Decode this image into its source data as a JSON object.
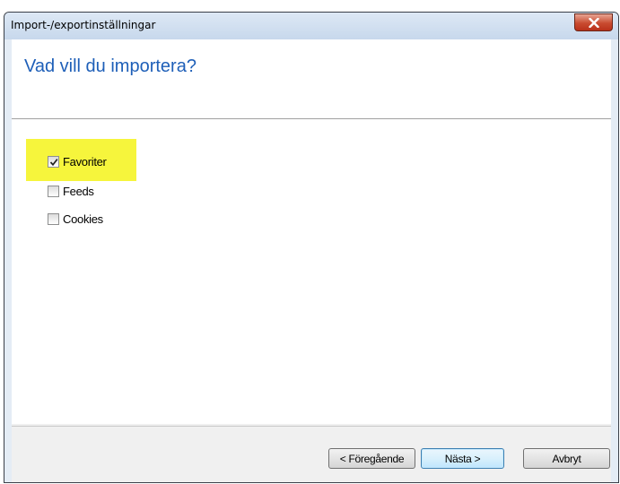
{
  "window": {
    "title": "Import-/exportinställningar"
  },
  "header": {
    "heading": "Vad vill du importera?"
  },
  "options": [
    {
      "label": "Favoriter",
      "checked": true,
      "highlighted": true
    },
    {
      "label": "Feeds",
      "checked": false,
      "highlighted": false
    },
    {
      "label": "Cookies",
      "checked": false,
      "highlighted": false
    }
  ],
  "buttons": {
    "back": "< Föregående",
    "next": "Nästa >",
    "cancel": "Avbryt"
  },
  "colors": {
    "heading": "#1e5fb8",
    "highlight": "#f6f53c",
    "close_button": "#c94b30"
  },
  "icons": {
    "close": "close-icon",
    "check": "checkmark-icon"
  }
}
